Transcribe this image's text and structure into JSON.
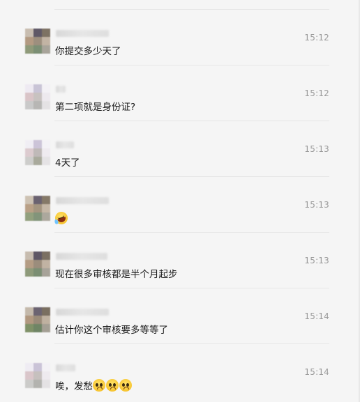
{
  "messages": [
    {
      "time": "15:12",
      "text": "你提交多少天了",
      "emojis": [],
      "avatar_colors": [
        "#c8bdb0",
        "#5f5866",
        "#7d7263",
        "#b39a82",
        "#9d8f7e",
        "#c2b4a4",
        "#8f9a7a",
        "#7c8f75",
        "#a8a49a"
      ]
    },
    {
      "time": "15:12",
      "text": "第二项就是身份证?",
      "emojis": [],
      "avatar_colors": [
        "#eeeaf2",
        "#c9c4d6",
        "#f3f1f5",
        "#d9c4c7",
        "#c8c2c0",
        "#ede9ee",
        "#c9c9c9",
        "#b7b6b4",
        "#e4e2e4"
      ]
    },
    {
      "time": "15:13",
      "text": "4天了",
      "emojis": [],
      "avatar_colors": [
        "#f0eef4",
        "#ccc4d8",
        "#f4f2f6",
        "#dccbcf",
        "#bfb9b8",
        "#efebf0",
        "#cdcdcb",
        "#a9aa9c",
        "#e5e3e5"
      ]
    },
    {
      "time": "15:13",
      "text": "",
      "emojis": [
        "laughing-crying-emoji"
      ],
      "avatar_colors": [
        "#cdc2b3",
        "#6a6270",
        "#857968",
        "#b9a086",
        "#a49580",
        "#c5b7a6",
        "#92a07e",
        "#82947a",
        "#aca89d"
      ]
    },
    {
      "time": "15:13",
      "text": "现在很多审核都是半个月起步",
      "emojis": [],
      "avatar_colors": [
        "#c7bcaf",
        "#5e5665",
        "#7b7062",
        "#b49c84",
        "#9b8d7c",
        "#c1b3a3",
        "#8e9a7a",
        "#7b8e73",
        "#a7a399"
      ]
    },
    {
      "time": "15:14",
      "text": "估计你这个审核要多等等了",
      "emojis": [],
      "avatar_colors": [
        "#c4b9ab",
        "#6b6371",
        "#7a6f60",
        "#b19880",
        "#9a8b79",
        "#bfb1a0",
        "#7f9168",
        "#6f8565",
        "#a49f94"
      ]
    },
    {
      "time": "15:14",
      "text": "唉，发愁",
      "emojis": [
        "pleading-emoji",
        "pleading-emoji",
        "pleading-emoji"
      ],
      "avatar_colors": [
        "#efecf3",
        "#cac3d7",
        "#f3f1f5",
        "#dac6ca",
        "#c6c0be",
        "#eeeaef",
        "#cbcbc9",
        "#b3b3af",
        "#e4e2e4"
      ]
    }
  ]
}
